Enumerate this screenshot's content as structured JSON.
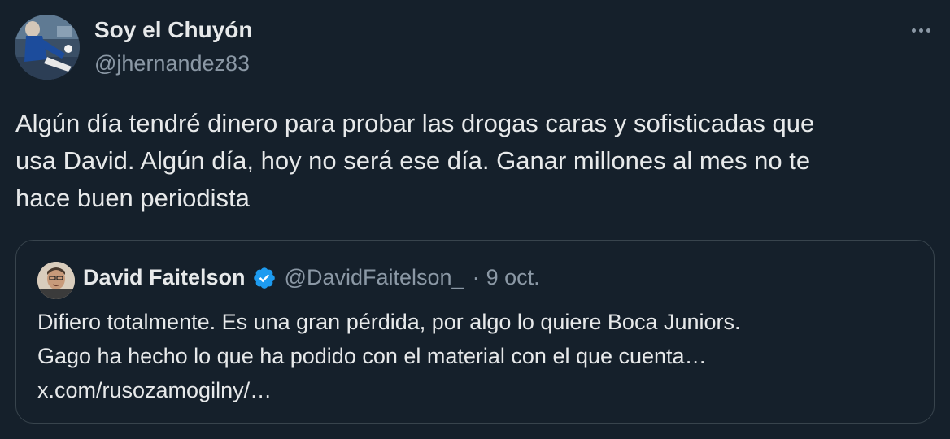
{
  "tweet": {
    "author_name": "Soy el Chuyón",
    "author_handle": "@jhernandez83",
    "text_lines": [
      "Algún día tendré dinero para probar las drogas caras y sofisticadas que",
      "usa David. Algún día, hoy no será ese día. Ganar millones al mes no te",
      "hace buen periodista"
    ],
    "more_icon": "more-horizontal-icon"
  },
  "quoted_tweet": {
    "author_name": "David Faitelson",
    "verified_icon": "verified-badge-icon",
    "author_handle": "@DavidFaitelson_",
    "separator": "·",
    "date": "9 oct.",
    "text_lines": [
      "Difiero totalmente. Es una gran pérdida, por algo lo quiere Boca Juniors.",
      "Gago ha hecho lo que ha podido con el material con el que cuenta…",
      "x.com/rusozamogilny/…"
    ]
  },
  "colors": {
    "background": "#15202b",
    "text_primary": "#e7e9ea",
    "text_secondary": "#8b98a5",
    "border": "#38444d",
    "verified_blue": "#1d9bf0"
  }
}
